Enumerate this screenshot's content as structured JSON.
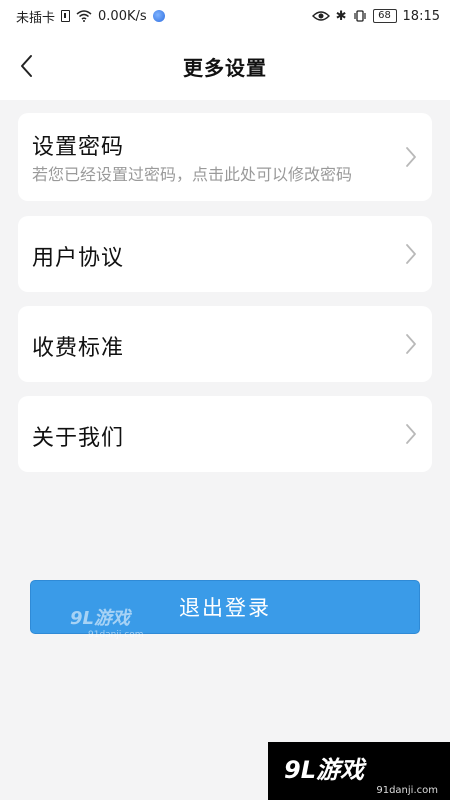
{
  "status_bar": {
    "carrier": "未插卡",
    "speed": "0.00K/s",
    "battery": "68",
    "time": "18:15"
  },
  "header": {
    "title": "更多设置"
  },
  "menu": [
    {
      "title": "设置密码",
      "description": "若您已经设置过密码，点击此处可以修改密码"
    },
    {
      "title": "用户协议"
    },
    {
      "title": "收费标准"
    },
    {
      "title": "关于我们"
    }
  ],
  "logout_label": "退出登录",
  "watermark": {
    "name": "9L游戏",
    "domain": "91danji.com"
  },
  "colors": {
    "accent": "#3a9be8",
    "background": "#f4f4f5",
    "card": "#ffffff",
    "secondary_text": "#9a9a9a"
  }
}
